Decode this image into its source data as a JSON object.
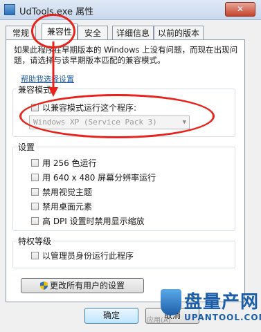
{
  "window": {
    "title": "UdTools.exe 属性",
    "close_label": "✕"
  },
  "tabs": [
    {
      "label": "常规"
    },
    {
      "label": "兼容性"
    },
    {
      "label": "安全"
    },
    {
      "label": "详细信息"
    },
    {
      "label": "以前的版本"
    }
  ],
  "description": "如果此程序在早期版本的 Windows 上没有问题，而现在出现问题，请选择与该早期版本匹配的兼容模式。",
  "help_link": "帮助我选择设置",
  "compat_mode": {
    "legend": "兼容模式",
    "checkbox_label": "以兼容模式运行这个程序:",
    "os_value": "Windows XP (Service Pack 3)"
  },
  "settings": {
    "legend": "设置",
    "options": [
      {
        "label": "用 256 色运行"
      },
      {
        "label": "用 640 x 480 屏幕分辨率运行"
      },
      {
        "label": "禁用视觉主题"
      },
      {
        "label": "禁用桌面元素"
      },
      {
        "label": "高 DPI 设置时禁用显示缩放"
      }
    ]
  },
  "privilege": {
    "legend": "特权等级",
    "checkbox_label": "以管理员身份运行此程序"
  },
  "change_all_button": "更改所有用户的设置",
  "ok_button": "确定",
  "cancel_button": "取消",
  "watermark": {
    "title": "盘量产网",
    "url": "UPANTOOL.COM",
    "faint_text": "应用(A)"
  },
  "colors": {
    "annotation": "#e8231c",
    "link": "#1f5aa6",
    "watermark": "#1d5ea8"
  }
}
